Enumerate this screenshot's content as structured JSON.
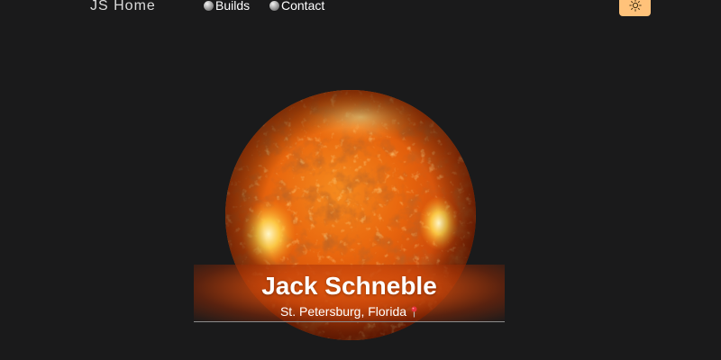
{
  "nav": {
    "brand": "JS Home",
    "links": [
      {
        "label": "Builds",
        "icon": "sphere-bullet-icon"
      },
      {
        "label": "Contact",
        "icon": "sphere-bullet-icon"
      }
    ],
    "theme_toggle": {
      "icon": "sun-icon",
      "color": "#ffc27a"
    }
  },
  "hero": {
    "name": "Jack Schneble",
    "location": "St. Petersburg, Florida",
    "location_icon": "map-pin-icon"
  },
  "colors": {
    "background": "#1a1a1b",
    "accent": "#ffc27a",
    "sun_core": "#f07a12",
    "banner": "#de560e"
  }
}
